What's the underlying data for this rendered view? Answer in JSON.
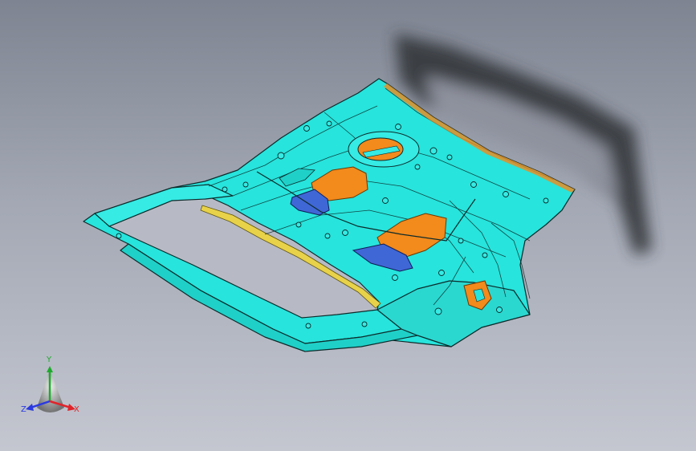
{
  "viewport": {
    "background_top": "#7e8491",
    "background_bottom": "#c4c7d0"
  },
  "model": {
    "part_color": "#27e4dc",
    "edge_color": "#0c2b2b",
    "pad_color": "#f28a1c",
    "foam_color": "#3f67d6",
    "strip_color": "#e8d24a",
    "shadow_color": "#2f3036"
  },
  "triad": {
    "x_label": "X",
    "y_label": "Y",
    "z_label": "Z",
    "x_color": "#e0242a",
    "y_color": "#1faa2e",
    "z_color": "#2a39e0"
  }
}
